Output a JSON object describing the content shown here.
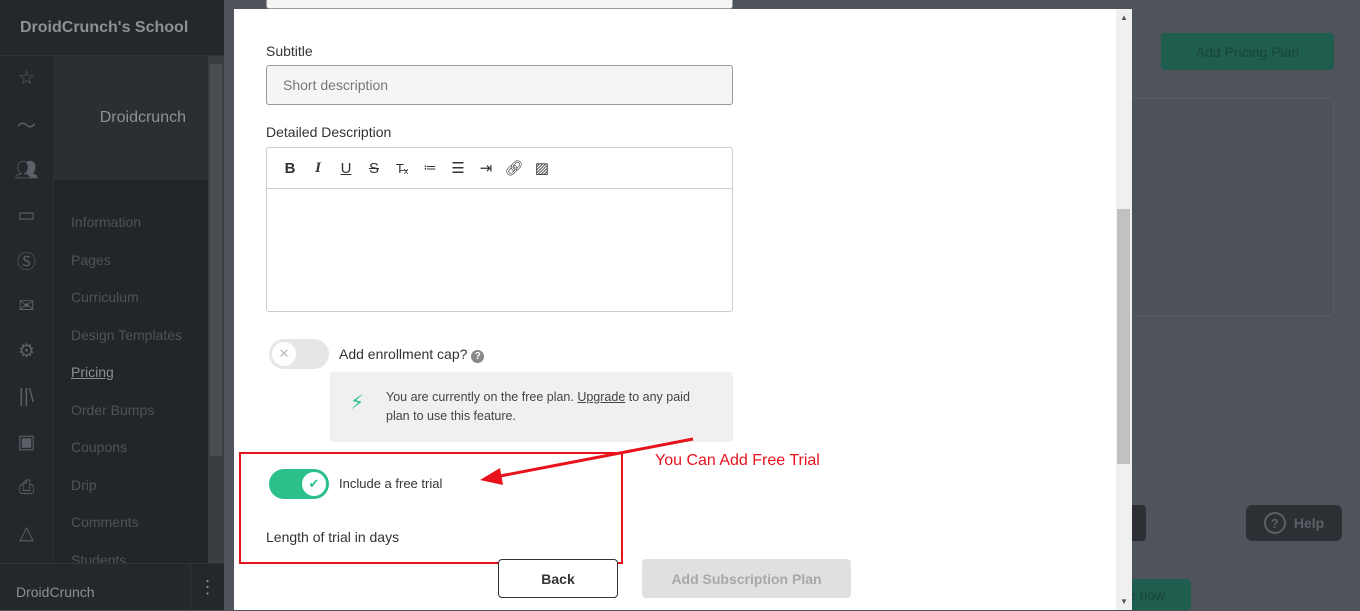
{
  "app": {
    "school_name": "DroidCrunch's School",
    "course_name": "Droidcrunch",
    "user_name": "DroidCrunch"
  },
  "sidebar": {
    "icons": [
      "star-icon",
      "analytics-icon",
      "users-icon",
      "devices-icon",
      "dollar-icon",
      "mail-icon",
      "gear-icon",
      "library-icon",
      "calendar-icon",
      "download-file-icon",
      "shapes-icon"
    ],
    "items": [
      {
        "label": "Information"
      },
      {
        "label": "Pages"
      },
      {
        "label": "Curriculum"
      },
      {
        "label": "Design Templates"
      },
      {
        "label": "Pricing",
        "active": true
      },
      {
        "label": "Order Bumps"
      },
      {
        "label": "Coupons"
      },
      {
        "label": "Drip"
      },
      {
        "label": "Comments"
      },
      {
        "label": "Students"
      }
    ]
  },
  "background": {
    "add_pricing_plan": "Add Pricing Plan",
    "help": "Help",
    "partial_button": "e now"
  },
  "modal": {
    "subtitle_label": "Subtitle",
    "subtitle_placeholder": "Short description",
    "description_label": "Detailed Description",
    "toolbar": [
      "B",
      "I",
      "U",
      "S",
      "Tx",
      "ol",
      "ul",
      "indent",
      "link",
      "image"
    ],
    "enrollment_cap": {
      "label": "Add enrollment cap?",
      "enabled": false
    },
    "notice": {
      "before": "You are currently on the free plan. ",
      "link": "Upgrade",
      "after": " to any paid plan to use this feature."
    },
    "free_trial": {
      "label": "Include a free trial",
      "enabled": true
    },
    "trial_length_label": "Length of trial in days",
    "back": "Back",
    "add_plan": "Add Subscription Plan"
  },
  "annotation": {
    "text": "You Can Add Free Trial",
    "color": "#e8121b"
  },
  "colors": {
    "accent": "#2bc08a",
    "sidebar": "#24282c"
  }
}
